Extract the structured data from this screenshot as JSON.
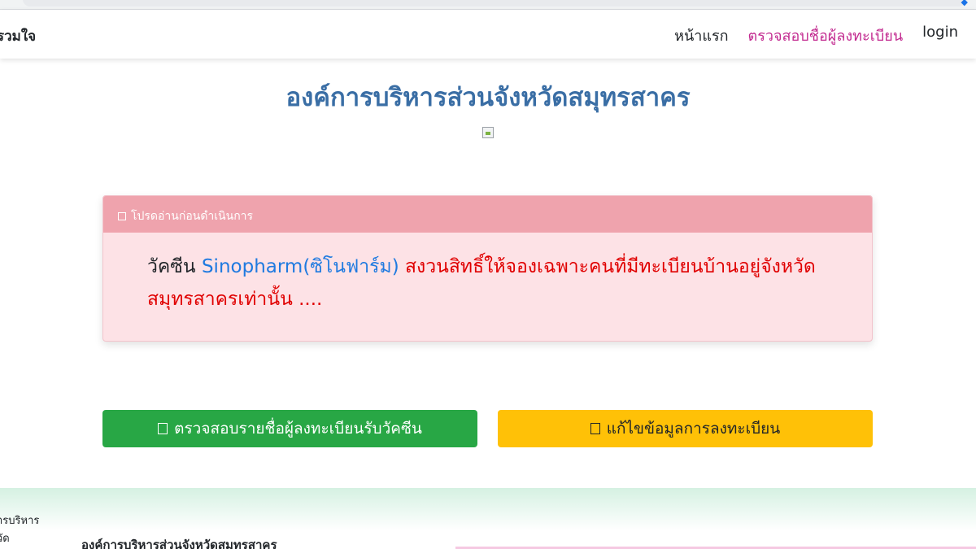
{
  "navbar": {
    "brand": "รวมใจ",
    "links": [
      {
        "label": "หน้าแรก",
        "active": false
      },
      {
        "label": "ตรวจสอบชื่อผู้ลงทะเบียน",
        "active": true
      },
      {
        "label": "login",
        "active": false
      }
    ]
  },
  "main": {
    "title": "องค์การบริหารส่วนจังหวัดสมุทรสาคร"
  },
  "alert": {
    "header": "โปรดอ่านก่อนดำเนินการ",
    "text_prefix": "วัคซีน",
    "vaccine_name": "Sinopharm(ซิโนฟาร์ม)",
    "text_rest": "สงวนสิทธิ์ให้จองเฉพาะคนที่มีทะเบียนบ้านอยู่จังหวัดสมุทรสาครเท่านั้น ...."
  },
  "buttons": {
    "check_list": "ตรวจสอบรายชื่อผู้ลงทะเบียนรับวัคซีน",
    "edit_registration": "แก้ไขข้อมูลการลงทะเบียน"
  },
  "footer": {
    "left_line1": "ารบริหาร",
    "left_line2": "วัด",
    "org_name": "องค์การบริหารส่วนจังหวัดสมุทรสาคร"
  },
  "colors": {
    "title_blue": "#3a6ea5",
    "nav_active": "#c2298f",
    "alert_header": "#efa3ad",
    "alert_bg": "#fde2e6",
    "btn_green": "#28a745",
    "btn_yellow": "#ffc107"
  }
}
